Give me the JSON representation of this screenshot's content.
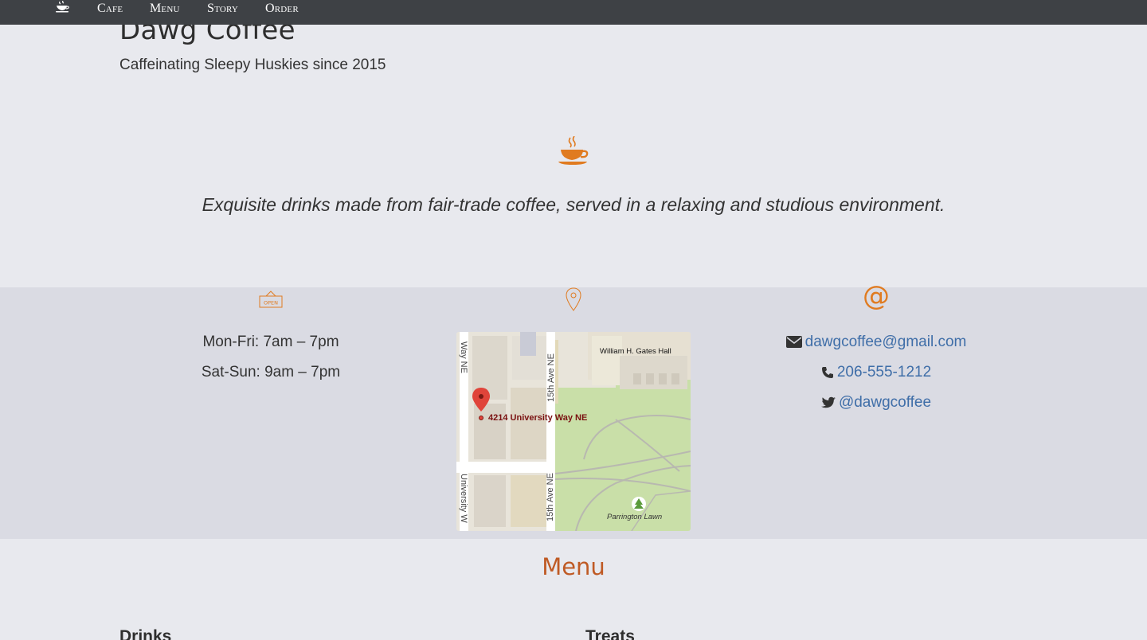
{
  "nav": {
    "brand_icon": "coffee-cup-icon",
    "items": [
      {
        "label": "Cafe"
      },
      {
        "label": "Menu"
      },
      {
        "label": "Story"
      },
      {
        "label": "Order"
      }
    ]
  },
  "header": {
    "title": "Dawg Coffee",
    "tagline": "Caffeinating Sleepy Huskies since 2015"
  },
  "hero": {
    "icon": "hot-coffee-icon",
    "text": "Exquisite drinks made from fair-trade coffee, served in a relaxing and studious environment."
  },
  "hours": {
    "icon": "open-sign-icon",
    "lines": [
      "Mon-Fri: 7am – 7pm",
      "Sat-Sun: 9am – 7pm"
    ]
  },
  "location": {
    "icon": "map-pin-icon",
    "map": {
      "address": "4214 University Way NE",
      "labels": {
        "gates_hall": "William H. Gates Hall",
        "way_ne_top": "Way NE",
        "ave_15_top": "15th Ave NE",
        "ave_15_bottom": "15th Ave NE",
        "university_bottom": "University W",
        "parrington": "Parrington Lawn"
      }
    }
  },
  "contact": {
    "icon": "at-icon",
    "email": "dawgcoffee@gmail.com",
    "phone": "206-555-1212",
    "twitter": "@dawgcoffee"
  },
  "menu": {
    "heading": "Menu",
    "columns": [
      "Drinks",
      "Treats"
    ]
  },
  "colors": {
    "accent": "#e07b20",
    "menu_heading": "#bf5a24",
    "link": "#3f6ea8",
    "navbar": "#3e4145",
    "page_bg": "#e8e9ee",
    "band_bg": "#dadbe3"
  }
}
